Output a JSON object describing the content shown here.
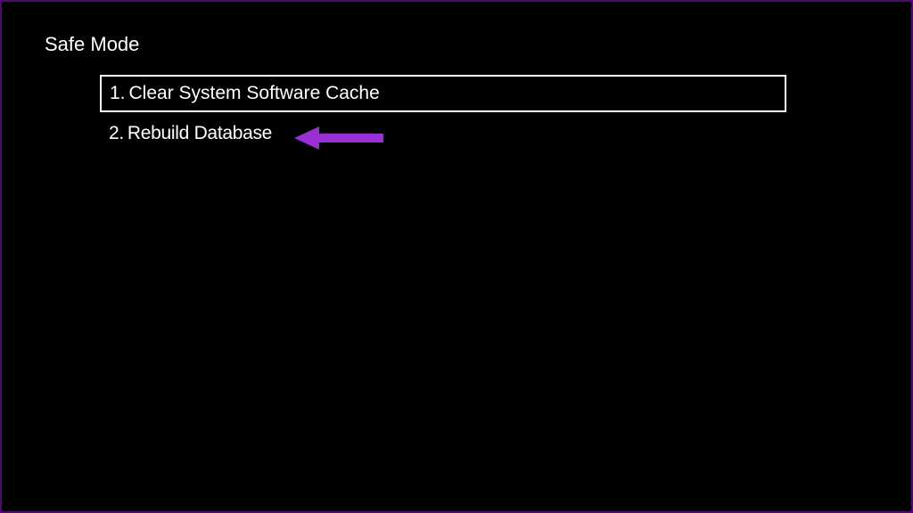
{
  "title": "Safe Mode",
  "menu": {
    "items": [
      {
        "number": "1.",
        "label": "Clear System Software Cache",
        "selected": true
      },
      {
        "number": "2.",
        "label": "Rebuild Database",
        "selected": false
      }
    ]
  },
  "annotation": {
    "arrow_color": "#9b2fd6"
  }
}
